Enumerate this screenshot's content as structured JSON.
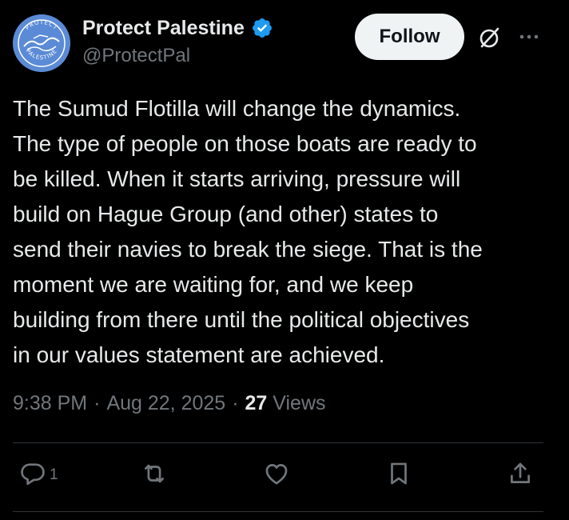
{
  "author": {
    "display_name": "Protect Palestine",
    "handle": "@ProtectPal",
    "verified": true,
    "avatar_logo_text": "PROTECT PALESTINE",
    "avatar_color": "#5b8bd6",
    "verified_color": "#1d9bf0"
  },
  "header": {
    "follow_label": "Follow",
    "grok_icon": "grok-icon",
    "more_icon": "more-icon"
  },
  "tweet": {
    "text": "The Sumud Flotilla will change the dynamics.\nThe type of people on those boats are ready to\nbe killed. When it starts arriving, pressure will\nbuild on Hague Group (and other) states to\nsend their navies to break the siege. That is the\nmoment we are waiting for, and we keep\nbuilding from there until the political objectives\nin our values statement are achieved."
  },
  "meta": {
    "time": "9:38 PM",
    "separator": "·",
    "date": "Aug 22, 2025",
    "views_count": "27",
    "views_label": "Views"
  },
  "actions": {
    "reply_count": "1",
    "icons": [
      "reply-icon",
      "retweet-icon",
      "like-icon",
      "bookmark-icon",
      "share-icon"
    ]
  },
  "colors": {
    "background": "#000000",
    "text": "#e7e9ea",
    "secondary": "#71767b",
    "divider": "#2f3336"
  }
}
